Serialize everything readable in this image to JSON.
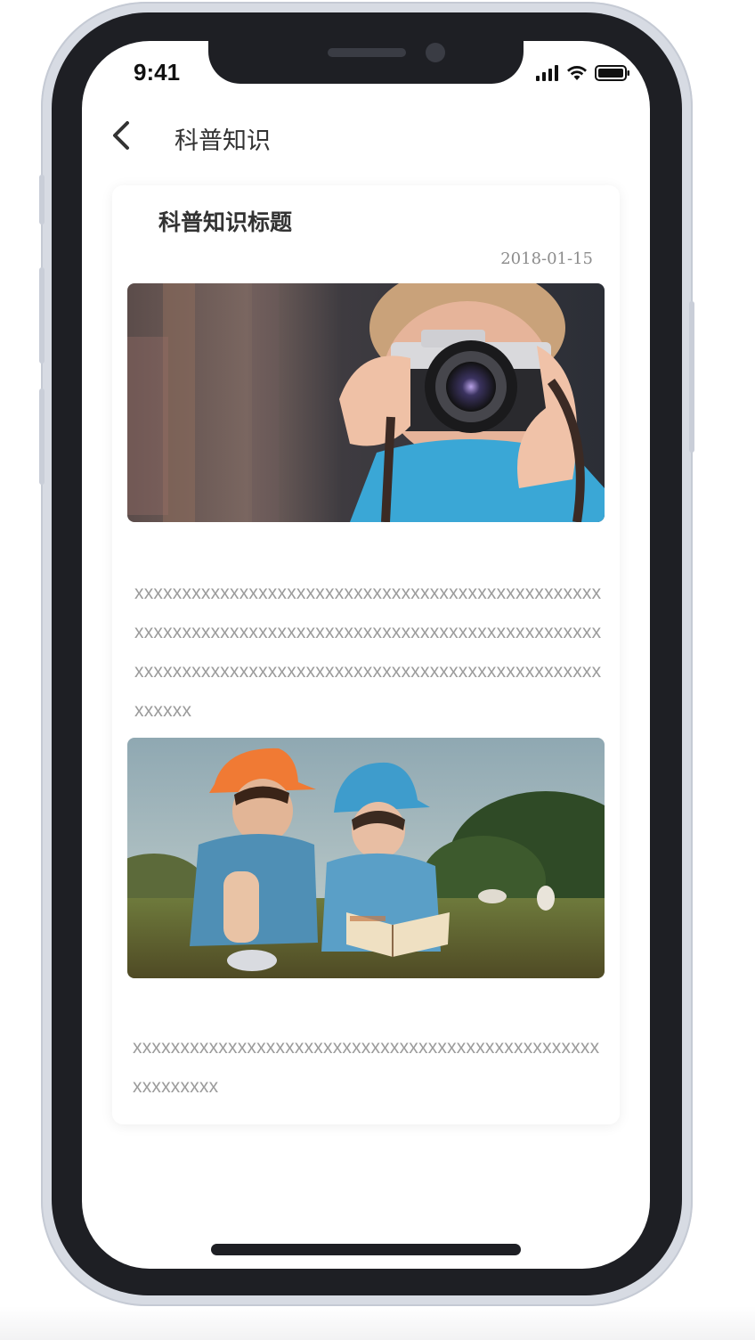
{
  "status_bar": {
    "time": "9:41",
    "signal_icon": "cellular-signal-icon",
    "wifi_icon": "wifi-icon",
    "battery_icon": "battery-icon"
  },
  "nav": {
    "back_icon": "chevron-left-icon",
    "title": "科普知识"
  },
  "article": {
    "title": "科普知识标题",
    "date": "2018-01-15",
    "image1": "boy-with-camera-photo",
    "paragraph1": "xxxxxxxxxxxxxxxxxxxxxxxxxxxxxxxxxxxxxxxxxxxxxxxxxxxxxxxxxxxxxxxxxxxxxxxxxxxxxxxxxxxxxxxxxxxxxxxxxxxxxxxxxxxxxxxxxxxxxxxxxxxxxxxxxxxxxxxxxxxxxxxxxxxxxxxxx",
    "image2": "children-reading-in-field-photo",
    "paragraph2": "xxxxxxxxxxxxxxxxxxxxxxxxxxxxxxxxxxxxxxxxxxxxxxxxxxxxxxxxxx"
  },
  "colors": {
    "text_primary": "#333333",
    "text_secondary": "#9b9b9b",
    "frame_dark": "#1e1f24"
  }
}
